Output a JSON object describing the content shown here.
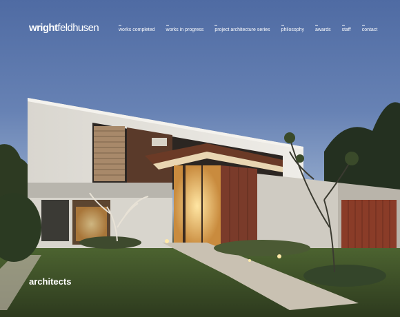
{
  "brand": {
    "logo_bold": "wright",
    "logo_light": "feldhusen"
  },
  "nav": [
    {
      "label": "works completed"
    },
    {
      "label": "works in progress"
    },
    {
      "label": "project architecture series"
    },
    {
      "label": "philosophy"
    },
    {
      "label": "awards"
    },
    {
      "label": "staff"
    },
    {
      "label": "contact"
    }
  ],
  "hero": {
    "caption": "architects"
  },
  "colors": {
    "sky": "#5b76ab",
    "lawn": "#3f5529",
    "timber": "#7a3b2a",
    "render": "#e6e3dc"
  }
}
